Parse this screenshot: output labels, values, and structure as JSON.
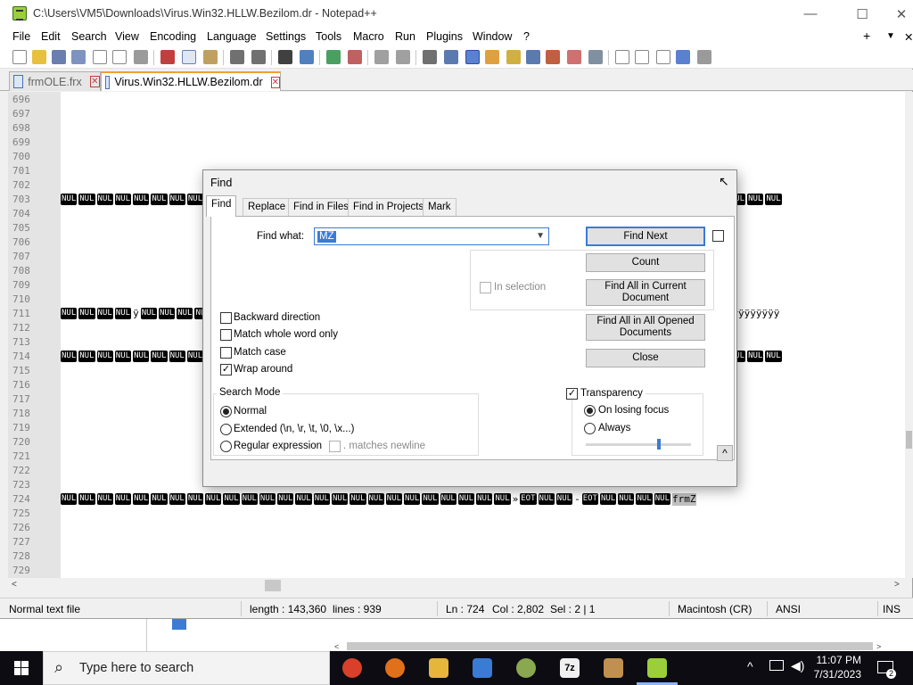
{
  "window": {
    "title": "C:\\Users\\VM5\\Downloads\\Virus.Win32.HLLW.Bezilom.dr - Notepad++",
    "minimize": "—",
    "maximize": "☐",
    "close": "✕",
    "menubar_right": [
      "+",
      "▼",
      "✕"
    ]
  },
  "menu": [
    "File",
    "Edit",
    "Search",
    "View",
    "Encoding",
    "Language",
    "Settings",
    "Tools",
    "Macro",
    "Run",
    "Plugins",
    "Window",
    "?"
  ],
  "tabs": [
    {
      "label": "frmOLE.frx",
      "active": false
    },
    {
      "label": "Virus.Win32.HLLW.Bezilom.dr",
      "active": true
    }
  ],
  "editor": {
    "line_numbers": [
      "696",
      "697",
      "698",
      "699",
      "700",
      "701",
      "702",
      "703",
      "704",
      "705",
      "706",
      "707",
      "708",
      "709",
      "710",
      "711",
      "712",
      "713",
      "714",
      "715",
      "716",
      "717",
      "718",
      "719",
      "720",
      "721",
      "722",
      "723",
      "724",
      "725",
      "726",
      "727",
      "728",
      "729"
    ],
    "nul_token": "NUL",
    "line_711_text": "ÿÿÿÿÿÿÿÿÿ",
    "line_724_tail": [
      "»",
      "EOT",
      "NUL",
      "NUL",
      "-",
      "EOT",
      "NUL",
      "NUL",
      "NUL",
      "NUL"
    ],
    "line_724_end": "frmZ"
  },
  "find_dialog": {
    "title": "Find",
    "tabs": [
      "Find",
      "Replace",
      "Find in Files",
      "Find in Projects",
      "Mark"
    ],
    "find_what_label": "Find what:",
    "find_what_value": "MZ",
    "in_selection_label": "In selection",
    "buttons": {
      "find_next": "Find Next",
      "count": "Count",
      "find_all_current": "Find All in Current Document",
      "find_all_opened": "Find All in All Opened Documents",
      "close": "Close",
      "collapse": "^"
    },
    "options": [
      {
        "label": "Backward direction",
        "checked": false
      },
      {
        "label": "Match whole word only",
        "checked": false
      },
      {
        "label": "Match case",
        "checked": false
      },
      {
        "label": "Wrap around",
        "checked": true
      }
    ],
    "search_mode": {
      "title": "Search Mode",
      "options": [
        {
          "label": "Normal",
          "selected": true
        },
        {
          "label": "Extended (\\n, \\r, \\t, \\0, \\x...)",
          "selected": false
        },
        {
          "label": "Regular expression",
          "selected": false
        }
      ],
      "matches_newline_label": ". matches newline"
    },
    "transparency": {
      "label": "Transparency",
      "checked": true,
      "options": [
        {
          "label": "On losing focus",
          "selected": true
        },
        {
          "label": "Always",
          "selected": false
        }
      ],
      "slider_value": 0.7
    }
  },
  "statusbar": {
    "file_type": "Normal text file",
    "length": "length : 143,360",
    "lines": "lines : 939",
    "ln": "Ln : 724",
    "col": "Col : 2,802",
    "sel": "Sel : 2 | 1",
    "eol": "Macintosh (CR)",
    "encoding": "ANSI",
    "mode": "INS"
  },
  "taskbar": {
    "search_placeholder": "Type here to search",
    "time": "11:07 PM",
    "date": "7/31/2023",
    "notification_count": "2"
  }
}
